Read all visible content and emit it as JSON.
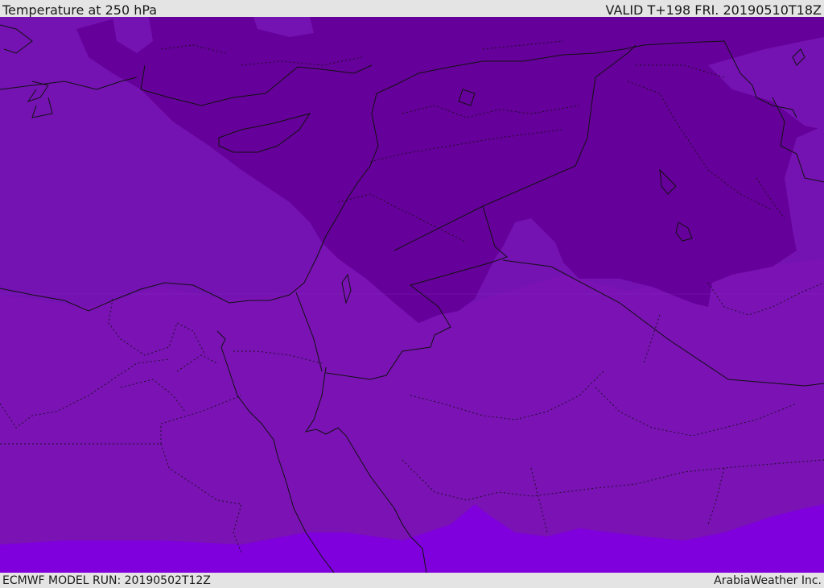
{
  "header": {
    "title": "Temperature at 250 hPa",
    "valid": "VALID T+198 FRI. 20190510T18Z"
  },
  "footer": {
    "model_run": "ECMWF MODEL RUN: 20190502T12Z",
    "credit": "ArabiaWeather Inc."
  },
  "map": {
    "field": "temperature",
    "level": "250 hPa",
    "colors": {
      "coldest": "#66009a",
      "cold": "#7412b2",
      "mid": "#7a12b4",
      "warm": "#7f00dd",
      "coastline": "#111111",
      "border": "#111111"
    }
  }
}
